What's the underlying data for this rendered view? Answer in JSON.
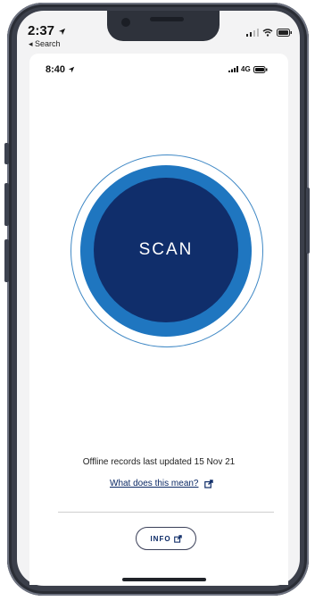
{
  "outer_status": {
    "time": "2:37",
    "back_label": "◂ Search"
  },
  "inner_status": {
    "time": "8:40",
    "network": "4G"
  },
  "scan": {
    "label": "SCAN"
  },
  "offline_text": "Offline records last updated 15 Nov 21",
  "help_link": "What does this mean?",
  "info_button": "INFO",
  "colors": {
    "scan_inner": "#102e6b",
    "scan_outer": "#1f76c0",
    "link": "#0c2a66"
  }
}
